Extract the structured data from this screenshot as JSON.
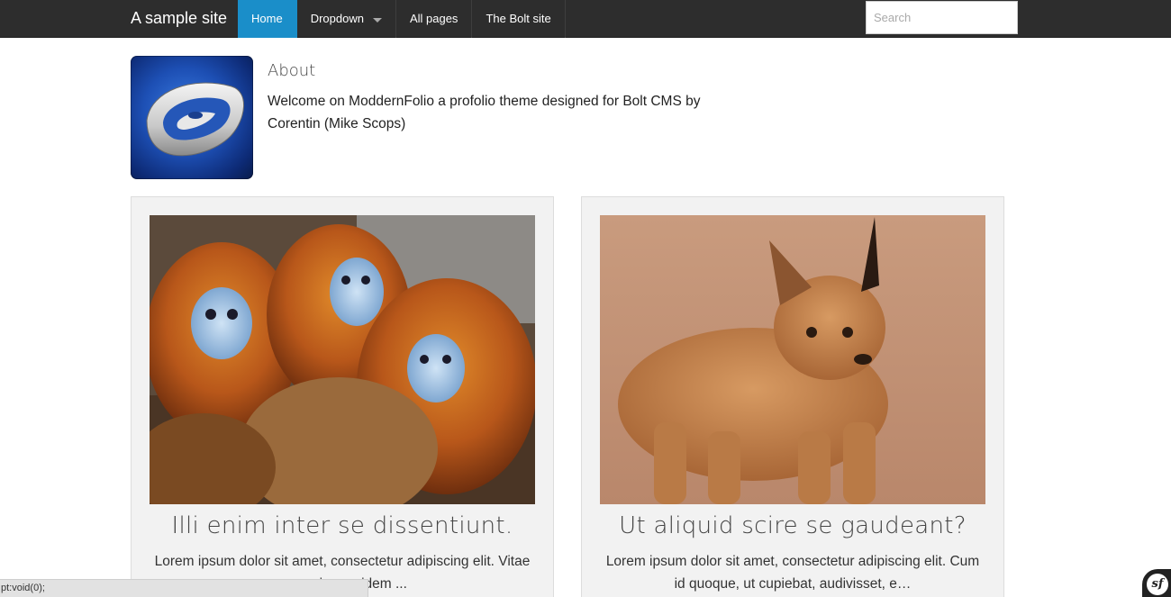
{
  "navbar": {
    "brand": "A sample site",
    "items": [
      {
        "label": "Home",
        "active": true
      },
      {
        "label": "Dropdown",
        "has_caret": true
      },
      {
        "label": "All pages"
      },
      {
        "label": "The Bolt site"
      }
    ],
    "search_placeholder": "Search"
  },
  "about": {
    "title": "About",
    "text": "Welcome on ModdernFolio a profolio theme designed for Bolt CMS by Corentin (Mike Scops)",
    "logo_icon": "bolt-eye-logo"
  },
  "cards": [
    {
      "image": "golden-snub-nosed-monkeys-photo",
      "title": "Illi enim inter se dissentiunt.",
      "text": "Lorem ipsum dolor sit amet, consectetur adipiscing elit. Vitae ... maxime quidem ..."
    },
    {
      "image": "caracal-kitten-photo",
      "title": "Ut aliquid scire se gaudeant?",
      "text": "Lorem ipsum dolor sit amet, consectetur adipiscing elit. Cum id quoque, ut cupiebat, audivisset, e…"
    }
  ],
  "statusbar": {
    "text": "pt:void(0);"
  },
  "debug_toolbar": {
    "label": "sf"
  },
  "colors": {
    "navbar_bg": "#2d2d2d",
    "nav_active": "#1a8ec9",
    "card_bg": "#f2f2f2"
  }
}
